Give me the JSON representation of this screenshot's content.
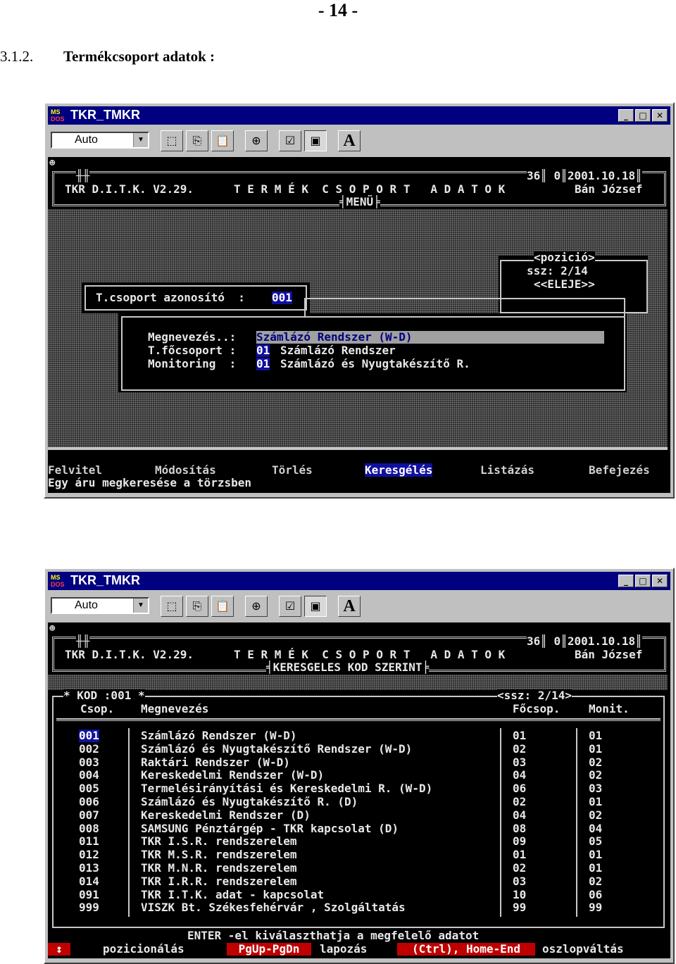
{
  "page_number": "- 14 -",
  "section": {
    "number": "3.1.2.",
    "title": "Termékcsoport adatok :"
  },
  "window_title": "TKR_TMKR",
  "window_icon_label": {
    "top": "MS",
    "bottom": "DOS"
  },
  "font_select": "Auto",
  "header": {
    "left": "TKR D.I.T.K. V2.29.",
    "center": "T E R M É K  C S O P O R T   A D A T O K",
    "num": "36",
    "zero": "0",
    "date": "2001.10.18",
    "user": "Bán József"
  },
  "screen1": {
    "subtitle": "MENÜ",
    "pos_label": "<pozició>",
    "ssz": "ssz: 2/14",
    "eleje": "<<ELEJE>>",
    "id_label": "T.csoport azonosító  :",
    "id_value": "001",
    "fields": [
      {
        "label": "Megnevezés..:",
        "code": "",
        "value": "Számlázó Rendszer (W-D)"
      },
      {
        "label": "T.főcsoport :",
        "code": "01",
        "value": "Számlázó Rendszer"
      },
      {
        "label": "Monitoring  :",
        "code": "01",
        "value": "Számlázó és Nyugtakészítő R."
      }
    ],
    "menu": [
      "Felvitel",
      "Módosítás",
      "Törlés",
      "Keresgélés",
      "Listázás",
      "Befejezés"
    ],
    "status": "Egy áru megkeresése a törzsben"
  },
  "screen2": {
    "subtitle": "KERESGELES KOD SZERINT",
    "kod": "* KOD :001 *",
    "ssz": "<ssz: 2/14>",
    "col_csop": "Csop.",
    "col_megn": "Megnevezés",
    "col_focsop": "Főcsop.",
    "col_monit": "Monit.",
    "rows": [
      {
        "csop": "001",
        "megn": "Számlázó Rendszer (W-D)",
        "focsop": "01",
        "monit": "01"
      },
      {
        "csop": "002",
        "megn": "Számlázó és Nyugtakészítő Rendszer (W-D)",
        "focsop": "02",
        "monit": "01"
      },
      {
        "csop": "003",
        "megn": "Raktári Rendszer (W-D)",
        "focsop": "03",
        "monit": "02"
      },
      {
        "csop": "004",
        "megn": "Kereskedelmi Rendszer (W-D)",
        "focsop": "04",
        "monit": "02"
      },
      {
        "csop": "005",
        "megn": "Termelésirányítási és Kereskedelmi R. (W-D)",
        "focsop": "06",
        "monit": "03"
      },
      {
        "csop": "006",
        "megn": "Számlázó és Nyugtakészítő R. (D)",
        "focsop": "02",
        "monit": "01"
      },
      {
        "csop": "007",
        "megn": "Kereskedelmi Rendszer (D)",
        "focsop": "04",
        "monit": "02"
      },
      {
        "csop": "008",
        "megn": "SAMSUNG Pénztárgép - TKR kapcsolat (D)",
        "focsop": "08",
        "monit": "04"
      },
      {
        "csop": "011",
        "megn": "TKR I.S.R. rendszerelem",
        "focsop": "09",
        "monit": "05"
      },
      {
        "csop": "012",
        "megn": "TKR M.S.R. rendszerelem",
        "focsop": "01",
        "monit": "01"
      },
      {
        "csop": "013",
        "megn": "TKR M.N.R. rendszerelem",
        "focsop": "02",
        "monit": "01"
      },
      {
        "csop": "014",
        "megn": "TKR I.R.R. rendszerelem",
        "focsop": "03",
        "monit": "02"
      },
      {
        "csop": "091",
        "megn": "TKR I.T.K. adat - kapcsolat",
        "focsop": "10",
        "monit": "06"
      },
      {
        "csop": "999",
        "megn": "VISZK Bt. Székesfehérvár , Szolgáltatás",
        "focsop": "99",
        "monit": "99"
      }
    ],
    "enter_hint": "ENTER -el kiválaszthatja a megfelelő adatot",
    "status": {
      "arrow": "↕",
      "pos": "pozicionálás",
      "pg": "PgUp-PgDn",
      "lap": "lapozás",
      "ctrl": "(Ctrl), Home-End",
      "osz": "oszlopváltás"
    }
  }
}
